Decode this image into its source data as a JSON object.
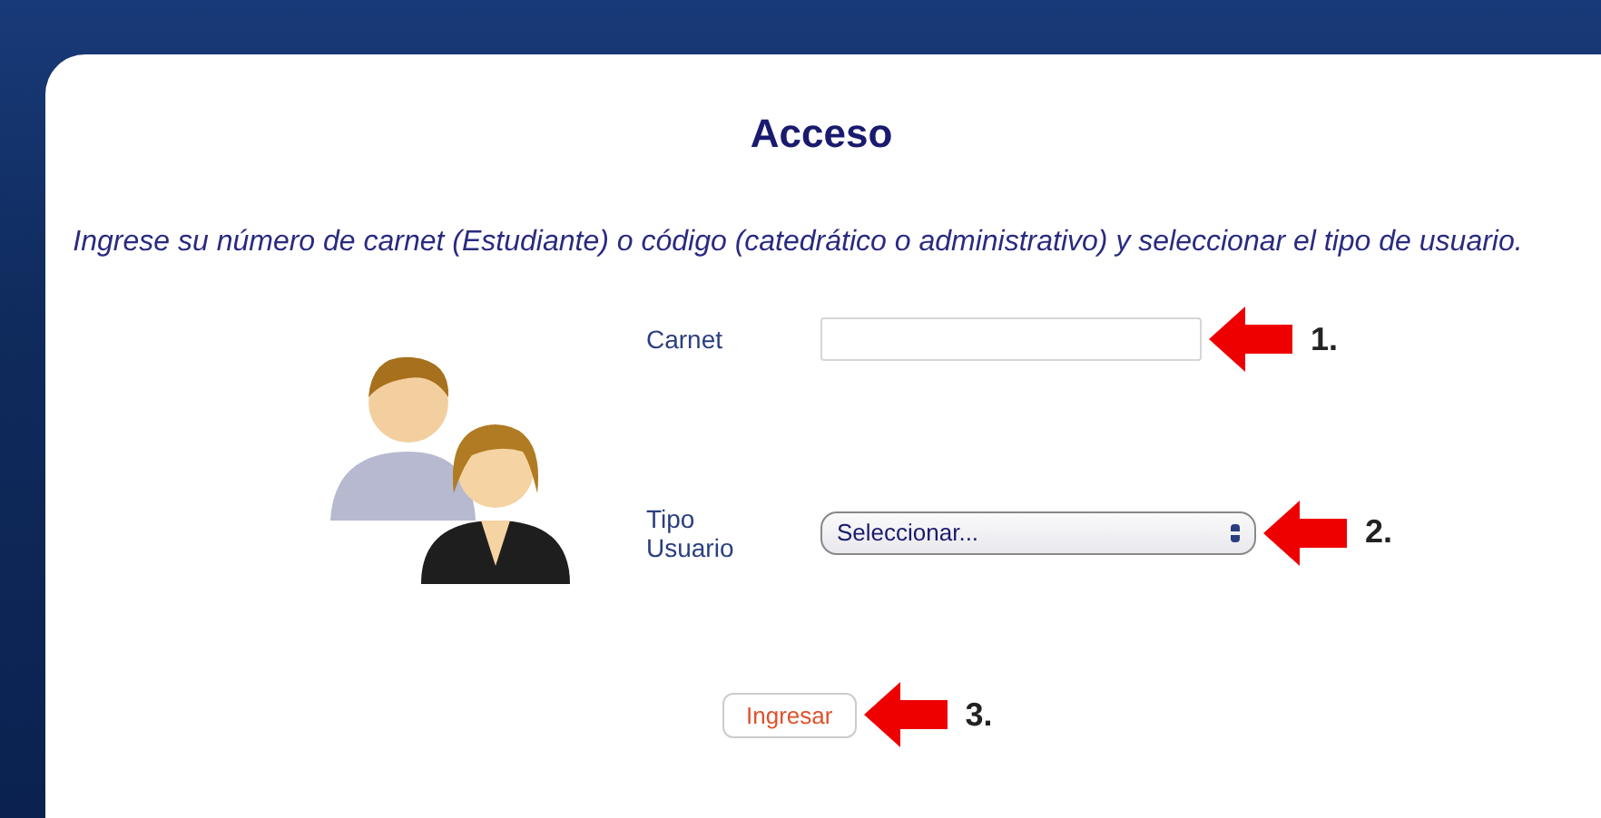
{
  "panel": {
    "title": "Acceso",
    "instructions": "Ingrese su número de carnet (Estudiante) o código (catedrático o administrativo) y seleccionar el tipo de usuario."
  },
  "form": {
    "fields": [
      {
        "kind": "text",
        "label": "Carnet",
        "callout": "1."
      },
      {
        "kind": "select",
        "label": "Tipo Usuario",
        "value": "Seleccionar...",
        "callout": "2."
      }
    ],
    "submit": {
      "label": "Ingresar",
      "callout": "3."
    }
  }
}
